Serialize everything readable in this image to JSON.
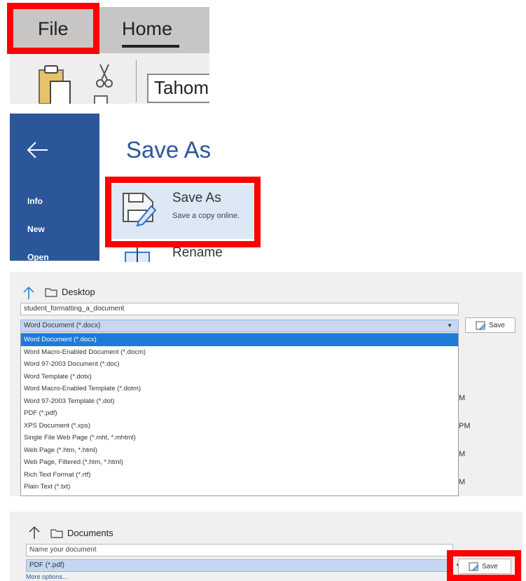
{
  "ribbon": {
    "file_tab": "File",
    "home_tab": "Home",
    "font_name": "Tahom"
  },
  "backstage": {
    "nav": [
      "Info",
      "New",
      "Open"
    ],
    "title": "Save As",
    "save_as_label": "Save As",
    "save_as_desc": "Save a copy online.",
    "rename_label": "Rename"
  },
  "dialog1": {
    "location": "Desktop",
    "filename": "student_formatting_a_document",
    "file_type": "Word Document (*.docx)",
    "save_label": "Save",
    "file_types": [
      "Word Document (*.docx)",
      "Word Macro-Enabled Document (*.docm)",
      "Word 97-2003 Document (*.doc)",
      "Word Template (*.dotx)",
      "Word Macro-Enabled Template (*.dotm)",
      "Word 97-2003 Template (*.dot)",
      "PDF (*.pdf)",
      "XPS Document (*.xps)",
      "Single File Web Page (*.mht, *.mhtml)",
      "Web Page (*.htm, *.html)",
      "Web Page, Filtered (*.htm, *.html)",
      "Rich Text Format (*.rtf)",
      "Plain Text (*.txt)"
    ],
    "time_fragments": [
      "M",
      "PM",
      "M",
      "M"
    ]
  },
  "dialog2": {
    "location": "Documents",
    "filename_placeholder": "Name your document",
    "file_type": "PDF (*.pdf)",
    "more_options": "More options...",
    "save_label": "Save"
  },
  "colors": {
    "highlight": "#ff0000",
    "word_blue": "#2b579a",
    "selected_item": "#1e7bd8"
  }
}
